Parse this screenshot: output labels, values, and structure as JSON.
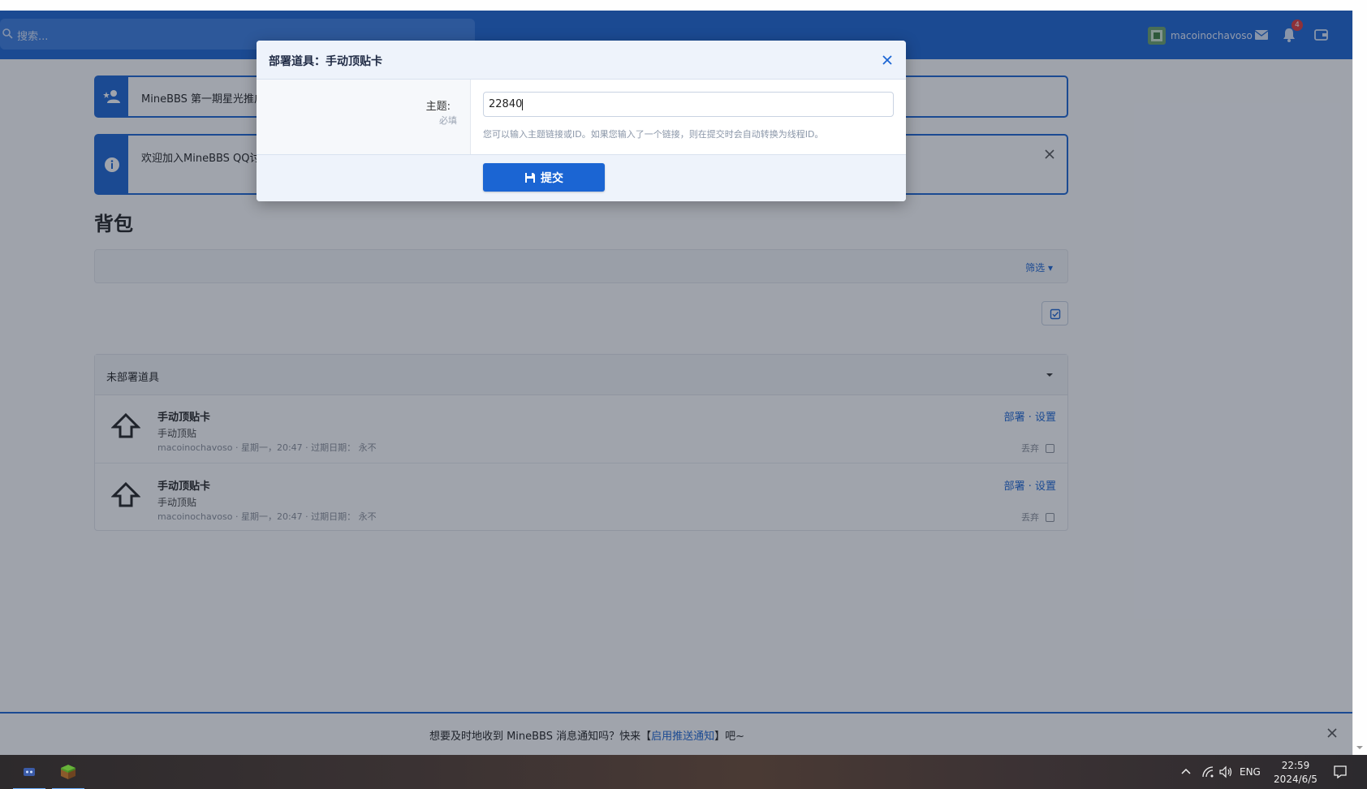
{
  "navbar": {
    "search_placeholder": "搜索...",
    "username": "macoinochavoso",
    "notification_count": "4"
  },
  "notices": [
    {
      "text": "MineBBS 第一期星光推广",
      "icon": "user-star-icon"
    },
    {
      "text": "欢迎加入MineBBS QQ讨",
      "icon": "info-icon"
    }
  ],
  "page": {
    "title": "背包",
    "filter_label": "筛选"
  },
  "inventory": {
    "section_title": "未部署道具",
    "items": [
      {
        "title": "手动顶贴卡",
        "description": "手动顶贴",
        "meta": "macoinochavoso · 星期一，20:47 · 过期日期：  永不",
        "action_deploy": "部署",
        "action_separator": " · ",
        "action_settings": "设置",
        "discard_label": "丢弃"
      },
      {
        "title": "手动顶贴卡",
        "description": "手动顶贴",
        "meta": "macoinochavoso · 星期一，20:47 · 过期日期：  永不",
        "action_deploy": "部署",
        "action_separator": " · ",
        "action_settings": "设置",
        "discard_label": "丢弃"
      }
    ]
  },
  "modal": {
    "title": "部署道具：手动顶贴卡",
    "field_label": "主题:",
    "field_required": "必填",
    "field_value": "22840",
    "hint": "您可以输入主题链接或ID。如果您输入了一个链接，则在提交时会自动转换为线程ID。",
    "submit_label": "提交"
  },
  "push_bar": {
    "text_before": "想要及时地收到 MineBBS 消息通知吗？快来【",
    "link_text": "启用推送通知",
    "text_after": "】吧~"
  },
  "taskbar": {
    "language": "ENG",
    "time": "22:59",
    "date": "2024/6/5"
  },
  "colors": {
    "brand": "#1b65d3",
    "overlay": "#1c263a"
  }
}
